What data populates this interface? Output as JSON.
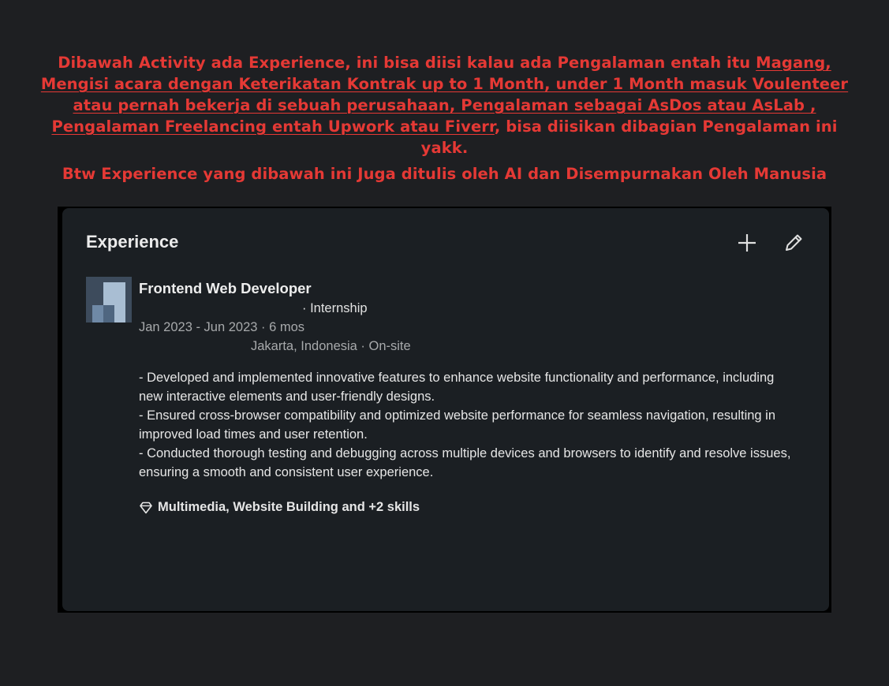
{
  "annotation": {
    "line1_pre": "Dibawah Activity ada Experience, ini bisa diisi kalau ada Pengalaman entah itu ",
    "line1_link": "Magang,",
    "line2_link": "Mengisi acara dengan Keterikatan Kontrak up to 1 Month, under 1 Month masuk Voulenteer",
    "line3_link": "atau pernah bekerja di sebuah perusahaan, Pengalaman sebagai AsDos atau AsLab ,",
    "line4_link": "Pengalaman Freelancing entah Upwork atau Fiverr",
    "line4_post": ", bisa diisikan dibagian Pengalaman ini yakk.",
    "note": "Btw Experience yang dibawah ini Juga ditulis oleh AI dan Disempurnakan Oleh Manusia",
    "color": "#e53935"
  },
  "experience": {
    "section_title": "Experience",
    "add_icon": "plus-icon",
    "edit_icon": "pencil-icon",
    "entry": {
      "logo_icon": "company-logo",
      "title": "Frontend Web Developer",
      "employment_type": "· Internship",
      "date_range": "Jan 2023 - Jun 2023 · 6 mos",
      "location": "Jakarta, Indonesia · On-site",
      "description": [
        "- Developed and implemented innovative features to enhance website functionality and performance, including new interactive elements and user-friendly designs.",
        "- Ensured cross-browser compatibility and optimized website performance for seamless navigation, resulting in improved load times and user retention.",
        "- Conducted thorough testing and debugging across multiple devices and browsers to identify and resolve issues, ensuring a smooth and consistent user experience."
      ],
      "skills_icon": "diamond-icon",
      "skills": "Multimedia, Website Building and +2 skills"
    }
  }
}
